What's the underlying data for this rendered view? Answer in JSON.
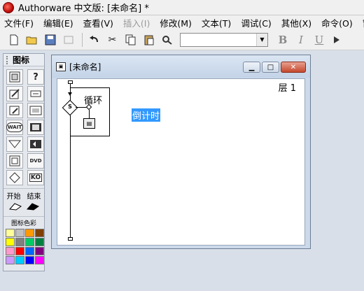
{
  "window": {
    "title": "Authorware 中文版: [未命名] *"
  },
  "menu": [
    {
      "label": "文件(F)",
      "disabled": false
    },
    {
      "label": "编辑(E)",
      "disabled": false
    },
    {
      "label": "查看(V)",
      "disabled": false
    },
    {
      "label": "插入(I)",
      "disabled": true
    },
    {
      "label": "修改(M)",
      "disabled": false
    },
    {
      "label": "文本(T)",
      "disabled": false
    },
    {
      "label": "调试(C)",
      "disabled": false
    },
    {
      "label": "其他(X)",
      "disabled": false
    },
    {
      "label": "命令(O)",
      "disabled": false
    },
    {
      "label": "窗口(",
      "disabled": false
    }
  ],
  "toolbar": {
    "font_combo_value": "",
    "bold_label": "B",
    "italic_label": "I",
    "underline_label": "U"
  },
  "palette": {
    "title": "图标",
    "start_label": "开始",
    "end_label": "结束",
    "color_label": "图标色彩",
    "icons": [
      "display-icon",
      "interaction-icon",
      "motion-icon",
      "calculation-icon",
      "erase-icon",
      "map-icon",
      "wait-icon",
      "digital-movie-icon",
      "navigate-icon",
      "sound-icon",
      "framework-icon",
      "dvd-icon",
      "decision-icon",
      "knowledge-object-icon"
    ],
    "icon_labels": {
      "wait-icon": "WAIT",
      "dvd-icon": "DVD",
      "knowledge-object-icon": "KO"
    },
    "swatches": [
      "#ffff99",
      "#c0c0c0",
      "#ff9900",
      "#804000",
      "#ffff00",
      "#808080",
      "#00cc66",
      "#008040",
      "#ff99cc",
      "#ff0000",
      "#0066ff",
      "#800080",
      "#cc99ff",
      "#00ccff",
      "#0000ff",
      "#ff00ff"
    ]
  },
  "flow_window": {
    "title": "[未命名]",
    "layer_label": "层 1",
    "loop_icon_title": "循环",
    "selected_icon_title": "倒计时",
    "decision_mark": "S"
  }
}
